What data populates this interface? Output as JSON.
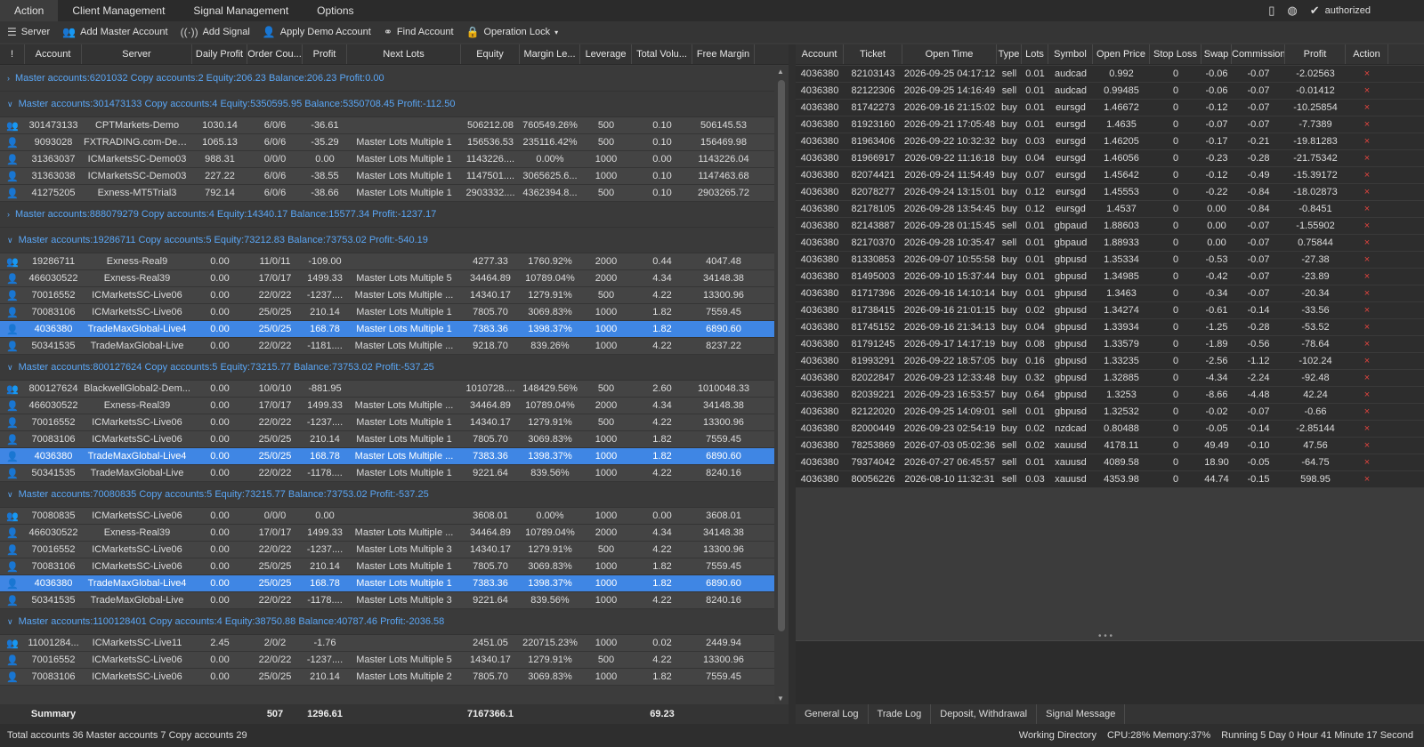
{
  "menu": {
    "items": [
      "Action",
      "Client Management",
      "Signal Management",
      "Options"
    ],
    "status": "authorized"
  },
  "toolbar": [
    "Server",
    "Add Master Account",
    "Add Signal",
    "Apply Demo Account",
    "Find Account",
    "Operation Lock"
  ],
  "left_table": {
    "headers": [
      "!",
      "Account",
      "Server",
      "Daily Profit",
      "Order Cou...",
      "Profit",
      "Next Lots",
      "Equity",
      "Margin Le...",
      "Leverage",
      "Total Volu...",
      "Free Margin"
    ],
    "groups": [
      {
        "title": "Master accounts:6201032 Copy accounts:2 Equity:206.23 Balance:206.23 Profit:0.00",
        "expanded": false,
        "rows": []
      },
      {
        "title": "Master accounts:301473133 Copy accounts:4 Equity:5350595.95 Balance:5350708.45 Profit:-112.50",
        "expanded": true,
        "rows": [
          [
            "301473133",
            "CPTMarkets-Demo",
            "1030.14",
            "6/0/6",
            "-36.61",
            "",
            "506212.08",
            "760549.26%",
            "500",
            "0.10",
            "506145.53"
          ],
          [
            "9093028",
            "FXTRADING.com-Demo",
            "1065.13",
            "6/0/6",
            "-35.29",
            "Master Lots Multiple 1",
            "156536.53",
            "235116.42%",
            "500",
            "0.10",
            "156469.98"
          ],
          [
            "31363037",
            "ICMarketsSC-Demo03",
            "988.31",
            "0/0/0",
            "0.00",
            "Master Lots Multiple 1",
            "1143226....",
            "0.00%",
            "1000",
            "0.00",
            "1143226.04"
          ],
          [
            "31363038",
            "ICMarketsSC-Demo03",
            "227.22",
            "6/0/6",
            "-38.55",
            "Master Lots Multiple 1",
            "1147501....",
            "3065625.6...",
            "1000",
            "0.10",
            "1147463.68"
          ],
          [
            "41275205",
            "Exness-MT5Trial3",
            "792.14",
            "6/0/6",
            "-38.66",
            "Master Lots Multiple 1",
            "2903332....",
            "4362394.8...",
            "500",
            "0.10",
            "2903265.72"
          ]
        ]
      },
      {
        "title": "Master accounts:888079279 Copy accounts:4 Equity:14340.17 Balance:15577.34 Profit:-1237.17",
        "expanded": false,
        "rows": []
      },
      {
        "title": "Master accounts:19286711 Copy accounts:5 Equity:73212.83 Balance:73753.02 Profit:-540.19",
        "expanded": true,
        "rows": [
          [
            "19286711",
            "Exness-Real9",
            "0.00",
            "11/0/11",
            "-109.00",
            "",
            "4277.33",
            "1760.92%",
            "2000",
            "0.44",
            "4047.48"
          ],
          [
            "466030522",
            "Exness-Real39",
            "0.00",
            "17/0/17",
            "1499.33",
            "Master Lots Multiple 5",
            "34464.89",
            "10789.04%",
            "2000",
            "4.34",
            "34148.38"
          ],
          [
            "70016552",
            "ICMarketsSC-Live06",
            "0.00",
            "22/0/22",
            "-1237....",
            "Master Lots Multiple ...",
            "14340.17",
            "1279.91%",
            "500",
            "4.22",
            "13300.96"
          ],
          [
            "70083106",
            "ICMarketsSC-Live06",
            "0.00",
            "25/0/25",
            "210.14",
            "Master Lots Multiple 1",
            "7805.70",
            "3069.83%",
            "1000",
            "1.82",
            "7559.45"
          ],
          [
            "4036380",
            "TradeMaxGlobal-Live4",
            "0.00",
            "25/0/25",
            "168.78",
            "Master Lots Multiple 1",
            "7383.36",
            "1398.37%",
            "1000",
            "1.82",
            "6890.60"
          ],
          [
            "50341535",
            "TradeMaxGlobal-Live",
            "0.00",
            "22/0/22",
            "-1181....",
            "Master Lots Multiple ...",
            "9218.70",
            "839.26%",
            "1000",
            "4.22",
            "8237.22"
          ]
        ]
      },
      {
        "title": "Master accounts:800127624 Copy accounts:5 Equity:73215.77 Balance:73753.02 Profit:-537.25",
        "expanded": true,
        "rows": [
          [
            "800127624",
            "BlackwellGlobal2-Dem...",
            "0.00",
            "10/0/10",
            "-881.95",
            "",
            "1010728....",
            "148429.56%",
            "500",
            "2.60",
            "1010048.33"
          ],
          [
            "466030522",
            "Exness-Real39",
            "0.00",
            "17/0/17",
            "1499.33",
            "Master Lots Multiple ...",
            "34464.89",
            "10789.04%",
            "2000",
            "4.34",
            "34148.38"
          ],
          [
            "70016552",
            "ICMarketsSC-Live06",
            "0.00",
            "22/0/22",
            "-1237....",
            "Master Lots Multiple 1",
            "14340.17",
            "1279.91%",
            "500",
            "4.22",
            "13300.96"
          ],
          [
            "70083106",
            "ICMarketsSC-Live06",
            "0.00",
            "25/0/25",
            "210.14",
            "Master Lots Multiple 1",
            "7805.70",
            "3069.83%",
            "1000",
            "1.82",
            "7559.45"
          ],
          [
            "4036380",
            "TradeMaxGlobal-Live4",
            "0.00",
            "25/0/25",
            "168.78",
            "Master Lots Multiple ...",
            "7383.36",
            "1398.37%",
            "1000",
            "1.82",
            "6890.60"
          ],
          [
            "50341535",
            "TradeMaxGlobal-Live",
            "0.00",
            "22/0/22",
            "-1178....",
            "Master Lots Multiple 1",
            "9221.64",
            "839.56%",
            "1000",
            "4.22",
            "8240.16"
          ]
        ]
      },
      {
        "title": "Master accounts:70080835 Copy accounts:5 Equity:73215.77 Balance:73753.02 Profit:-537.25",
        "expanded": true,
        "rows": [
          [
            "70080835",
            "ICMarketsSC-Live06",
            "0.00",
            "0/0/0",
            "0.00",
            "",
            "3608.01",
            "0.00%",
            "1000",
            "0.00",
            "3608.01"
          ],
          [
            "466030522",
            "Exness-Real39",
            "0.00",
            "17/0/17",
            "1499.33",
            "Master Lots Multiple ...",
            "34464.89",
            "10789.04%",
            "2000",
            "4.34",
            "34148.38"
          ],
          [
            "70016552",
            "ICMarketsSC-Live06",
            "0.00",
            "22/0/22",
            "-1237....",
            "Master Lots Multiple 3",
            "14340.17",
            "1279.91%",
            "500",
            "4.22",
            "13300.96"
          ],
          [
            "70083106",
            "ICMarketsSC-Live06",
            "0.00",
            "25/0/25",
            "210.14",
            "Master Lots Multiple 1",
            "7805.70",
            "3069.83%",
            "1000",
            "1.82",
            "7559.45"
          ],
          [
            "4036380",
            "TradeMaxGlobal-Live4",
            "0.00",
            "25/0/25",
            "168.78",
            "Master Lots Multiple 1",
            "7383.36",
            "1398.37%",
            "1000",
            "1.82",
            "6890.60"
          ],
          [
            "50341535",
            "TradeMaxGlobal-Live",
            "0.00",
            "22/0/22",
            "-1178....",
            "Master Lots Multiple 3",
            "9221.64",
            "839.56%",
            "1000",
            "4.22",
            "8240.16"
          ]
        ]
      },
      {
        "title": "Master accounts:1100128401 Copy accounts:4 Equity:38750.88 Balance:40787.46 Profit:-2036.58",
        "expanded": true,
        "rows": [
          [
            "11001284...",
            "ICMarketsSC-Live11",
            "2.45",
            "2/0/2",
            "-1.76",
            "",
            "2451.05",
            "220715.23%",
            "1000",
            "0.02",
            "2449.94"
          ],
          [
            "70016552",
            "ICMarketsSC-Live06",
            "0.00",
            "22/0/22",
            "-1237....",
            "Master Lots Multiple 5",
            "14340.17",
            "1279.91%",
            "500",
            "4.22",
            "13300.96"
          ],
          [
            "70083106",
            "ICMarketsSC-Live06",
            "0.00",
            "25/0/25",
            "210.14",
            "Master Lots Multiple 2",
            "7805.70",
            "3069.83%",
            "1000",
            "1.82",
            "7559.45"
          ]
        ]
      }
    ],
    "summary": {
      "label": "Summary",
      "order_count": "507",
      "profit": "1296.61",
      "equity": "7167366.1",
      "total_volume": "69.23"
    }
  },
  "right_table": {
    "headers": [
      "Account",
      "Ticket",
      "Open Time",
      "Type",
      "Lots",
      "Symbol",
      "Open Price",
      "Stop Loss",
      "Swap",
      "Commission",
      "Profit",
      "Action"
    ],
    "rows": [
      [
        "4036380",
        "82103143",
        "2026-09-25 04:17:12",
        "sell",
        "0.01",
        "audcad",
        "0.992",
        "0",
        "-0.06",
        "-0.07",
        "-2.02563"
      ],
      [
        "4036380",
        "82122306",
        "2026-09-25 14:16:49",
        "sell",
        "0.01",
        "audcad",
        "0.99485",
        "0",
        "-0.06",
        "-0.07",
        "-0.01412"
      ],
      [
        "4036380",
        "81742273",
        "2026-09-16 21:15:02",
        "buy",
        "0.01",
        "eursgd",
        "1.46672",
        "0",
        "-0.12",
        "-0.07",
        "-10.25854"
      ],
      [
        "4036380",
        "81923160",
        "2026-09-21 17:05:48",
        "buy",
        "0.01",
        "eursgd",
        "1.4635",
        "0",
        "-0.07",
        "-0.07",
        "-7.7389"
      ],
      [
        "4036380",
        "81963406",
        "2026-09-22 10:32:32",
        "buy",
        "0.03",
        "eursgd",
        "1.46205",
        "0",
        "-0.17",
        "-0.21",
        "-19.81283"
      ],
      [
        "4036380",
        "81966917",
        "2026-09-22 11:16:18",
        "buy",
        "0.04",
        "eursgd",
        "1.46056",
        "0",
        "-0.23",
        "-0.28",
        "-21.75342"
      ],
      [
        "4036380",
        "82074421",
        "2026-09-24 11:54:49",
        "buy",
        "0.07",
        "eursgd",
        "1.45642",
        "0",
        "-0.12",
        "-0.49",
        "-15.39172"
      ],
      [
        "4036380",
        "82078277",
        "2026-09-24 13:15:01",
        "buy",
        "0.12",
        "eursgd",
        "1.45553",
        "0",
        "-0.22",
        "-0.84",
        "-18.02873"
      ],
      [
        "4036380",
        "82178105",
        "2026-09-28 13:54:45",
        "buy",
        "0.12",
        "eursgd",
        "1.4537",
        "0",
        "0.00",
        "-0.84",
        "-0.8451"
      ],
      [
        "4036380",
        "82143887",
        "2026-09-28 01:15:45",
        "sell",
        "0.01",
        "gbpaud",
        "1.88603",
        "0",
        "0.00",
        "-0.07",
        "-1.55902"
      ],
      [
        "4036380",
        "82170370",
        "2026-09-28 10:35:47",
        "sell",
        "0.01",
        "gbpaud",
        "1.88933",
        "0",
        "0.00",
        "-0.07",
        "0.75844"
      ],
      [
        "4036380",
        "81330853",
        "2026-09-07 10:55:58",
        "buy",
        "0.01",
        "gbpusd",
        "1.35334",
        "0",
        "-0.53",
        "-0.07",
        "-27.38"
      ],
      [
        "4036380",
        "81495003",
        "2026-09-10 15:37:44",
        "buy",
        "0.01",
        "gbpusd",
        "1.34985",
        "0",
        "-0.42",
        "-0.07",
        "-23.89"
      ],
      [
        "4036380",
        "81717396",
        "2026-09-16 14:10:14",
        "buy",
        "0.01",
        "gbpusd",
        "1.3463",
        "0",
        "-0.34",
        "-0.07",
        "-20.34"
      ],
      [
        "4036380",
        "81738415",
        "2026-09-16 21:01:15",
        "buy",
        "0.02",
        "gbpusd",
        "1.34274",
        "0",
        "-0.61",
        "-0.14",
        "-33.56"
      ],
      [
        "4036380",
        "81745152",
        "2026-09-16 21:34:13",
        "buy",
        "0.04",
        "gbpusd",
        "1.33934",
        "0",
        "-1.25",
        "-0.28",
        "-53.52"
      ],
      [
        "4036380",
        "81791245",
        "2026-09-17 14:17:19",
        "buy",
        "0.08",
        "gbpusd",
        "1.33579",
        "0",
        "-1.89",
        "-0.56",
        "-78.64"
      ],
      [
        "4036380",
        "81993291",
        "2026-09-22 18:57:05",
        "buy",
        "0.16",
        "gbpusd",
        "1.33235",
        "0",
        "-2.56",
        "-1.12",
        "-102.24"
      ],
      [
        "4036380",
        "82022847",
        "2026-09-23 12:33:48",
        "buy",
        "0.32",
        "gbpusd",
        "1.32885",
        "0",
        "-4.34",
        "-2.24",
        "-92.48"
      ],
      [
        "4036380",
        "82039221",
        "2026-09-23 16:53:57",
        "buy",
        "0.64",
        "gbpusd",
        "1.3253",
        "0",
        "-8.66",
        "-4.48",
        "42.24"
      ],
      [
        "4036380",
        "82122020",
        "2026-09-25 14:09:01",
        "sell",
        "0.01",
        "gbpusd",
        "1.32532",
        "0",
        "-0.02",
        "-0.07",
        "-0.66"
      ],
      [
        "4036380",
        "82000449",
        "2026-09-23 02:54:19",
        "buy",
        "0.02",
        "nzdcad",
        "0.80488",
        "0",
        "-0.05",
        "-0.14",
        "-2.85144"
      ],
      [
        "4036380",
        "78253869",
        "2026-07-03 05:02:36",
        "sell",
        "0.02",
        "xauusd",
        "4178.11",
        "0",
        "49.49",
        "-0.10",
        "47.56"
      ],
      [
        "4036380",
        "79374042",
        "2026-07-27 06:45:57",
        "sell",
        "0.01",
        "xauusd",
        "4089.58",
        "0",
        "18.90",
        "-0.05",
        "-64.75"
      ],
      [
        "4036380",
        "80056226",
        "2026-08-10 11:32:31",
        "sell",
        "0.03",
        "xauusd",
        "4353.98",
        "0",
        "44.74",
        "-0.15",
        "598.95"
      ]
    ],
    "action_symbol": "×"
  },
  "log_tabs": [
    "General Log",
    "Trade Log",
    "Deposit, Withdrawal",
    "Signal Message"
  ],
  "status": {
    "left": "Total accounts 36 Master accounts 7 Copy accounts 29",
    "working_dir": "Working Directory",
    "cpu_mem": "CPU:28% Memory:37%",
    "running": "Running 5 Day 0 Hour 41 Minute 17 Second"
  }
}
